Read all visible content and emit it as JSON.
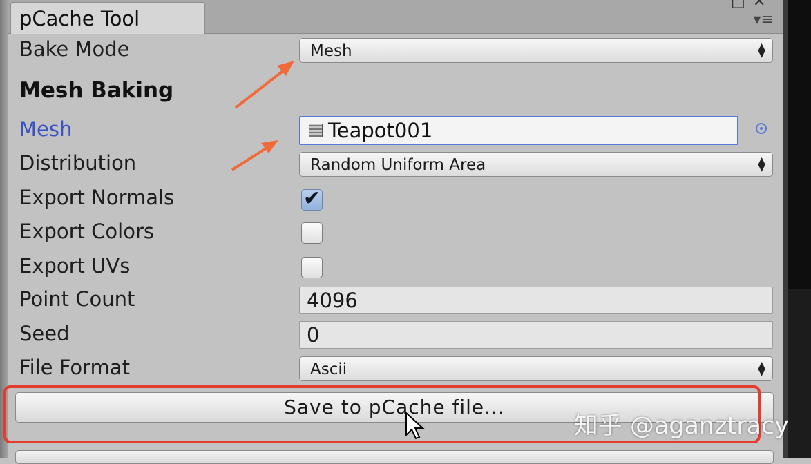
{
  "window": {
    "title": "pCache Tool"
  },
  "fields": {
    "bake_mode": {
      "label": "Bake Mode",
      "value": "Mesh"
    },
    "section_title": "Mesh Baking",
    "mesh": {
      "label": "Mesh",
      "value": "Teapot001"
    },
    "distribution": {
      "label": "Distribution",
      "value": "Random Uniform Area"
    },
    "export_normals": {
      "label": "Export Normals",
      "checked": true
    },
    "export_colors": {
      "label": "Export Colors",
      "checked": false
    },
    "export_uvs": {
      "label": "Export UVs",
      "checked": false
    },
    "point_count": {
      "label": "Point Count",
      "value": "4096"
    },
    "seed": {
      "label": "Seed",
      "value": "0"
    },
    "file_format": {
      "label": "File Format",
      "value": "Ascii"
    }
  },
  "save_button": {
    "label": "Save to pCache file..."
  },
  "watermark": "知乎 @aganztracy",
  "colors": {
    "annotation_arrow": "#f06a3a",
    "highlight_box": "#e43c2e",
    "mesh_label": "#3a52c4"
  }
}
